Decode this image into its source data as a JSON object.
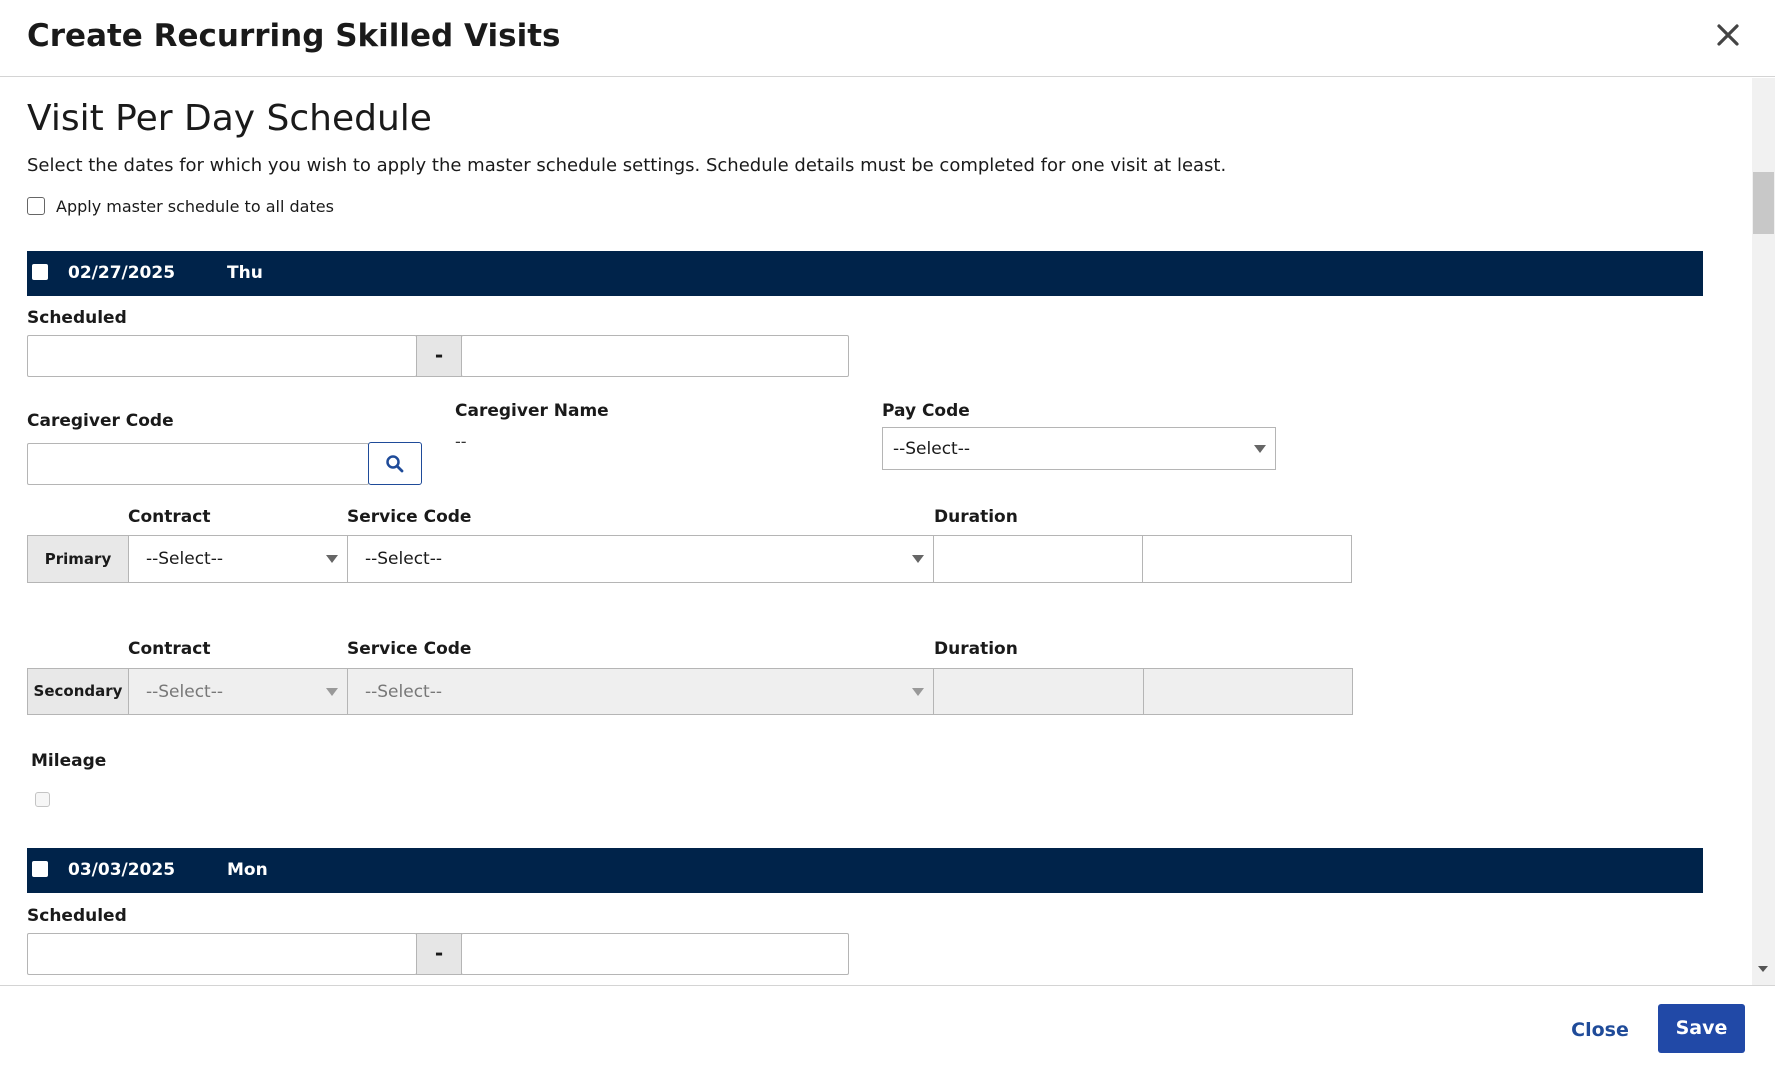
{
  "modal": {
    "title": "Create Recurring Skilled Visits"
  },
  "section": {
    "title": "Visit Per Day Schedule",
    "instructions": "Select the dates for which you wish to apply the master schedule settings. Schedule details must be completed for one visit at least.",
    "apply_all_label": "Apply master schedule to all dates"
  },
  "labels": {
    "scheduled": "Scheduled",
    "separator": "-",
    "caregiver_code": "Caregiver Code",
    "caregiver_name": "Caregiver Name",
    "pay_code": "Pay Code",
    "contract": "Contract",
    "service_code": "Service Code",
    "duration": "Duration",
    "primary": "Primary",
    "secondary": "Secondary",
    "mileage": "Mileage",
    "select_placeholder": "--Select--"
  },
  "visits": [
    {
      "date": "02/27/2025",
      "day": "Thu",
      "caregiver_name_value": "--"
    },
    {
      "date": "03/03/2025",
      "day": "Mon"
    }
  ],
  "footer": {
    "close_label": "Close",
    "save_label": "Save"
  },
  "colors": {
    "date_bar": "#00234a",
    "primary_button": "#2149a7",
    "link": "#1f4b99"
  },
  "icons": {
    "close": "close-icon",
    "search": "search-icon",
    "dropdown": "chevron-down-icon"
  }
}
